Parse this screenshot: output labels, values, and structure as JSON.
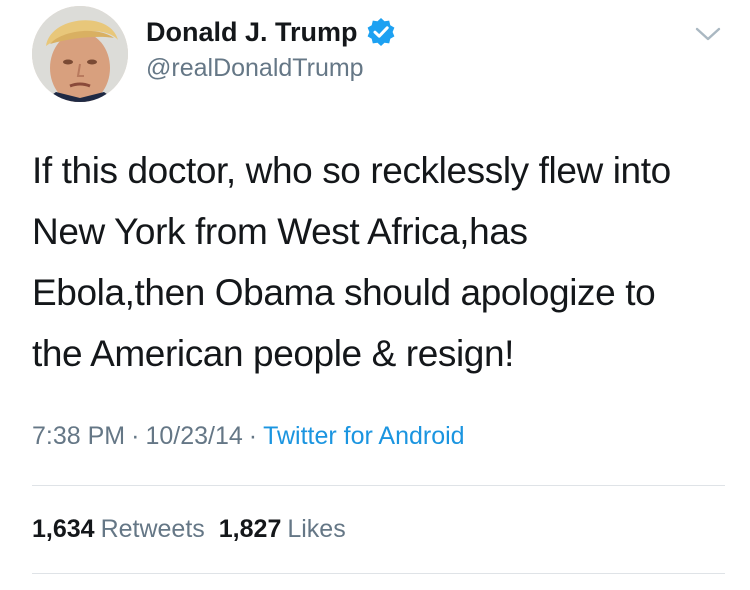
{
  "user": {
    "display_name": "Donald J. Trump",
    "handle": "@realDonaldTrump",
    "avatar_icon": "profile-photo",
    "verified_icon": "verified-badge-icon"
  },
  "tweet": {
    "text_lines": [
      "If this doctor, who so recklessly flew into",
      "New York from West Africa,has",
      "Ebola,then Obama should apologize to",
      "the American people & resign!"
    ]
  },
  "meta": {
    "time": "7:38 PM",
    "separator": "·",
    "date": "10/23/14",
    "source": "Twitter for Android"
  },
  "stats": {
    "retweets_count": "1,634",
    "retweets_label": "Retweets",
    "likes_count": "1,827",
    "likes_label": "Likes"
  },
  "colors": {
    "text": "#14171a",
    "secondary": "#657786",
    "accent": "#1b95e0",
    "divider": "#dfe3e7"
  }
}
